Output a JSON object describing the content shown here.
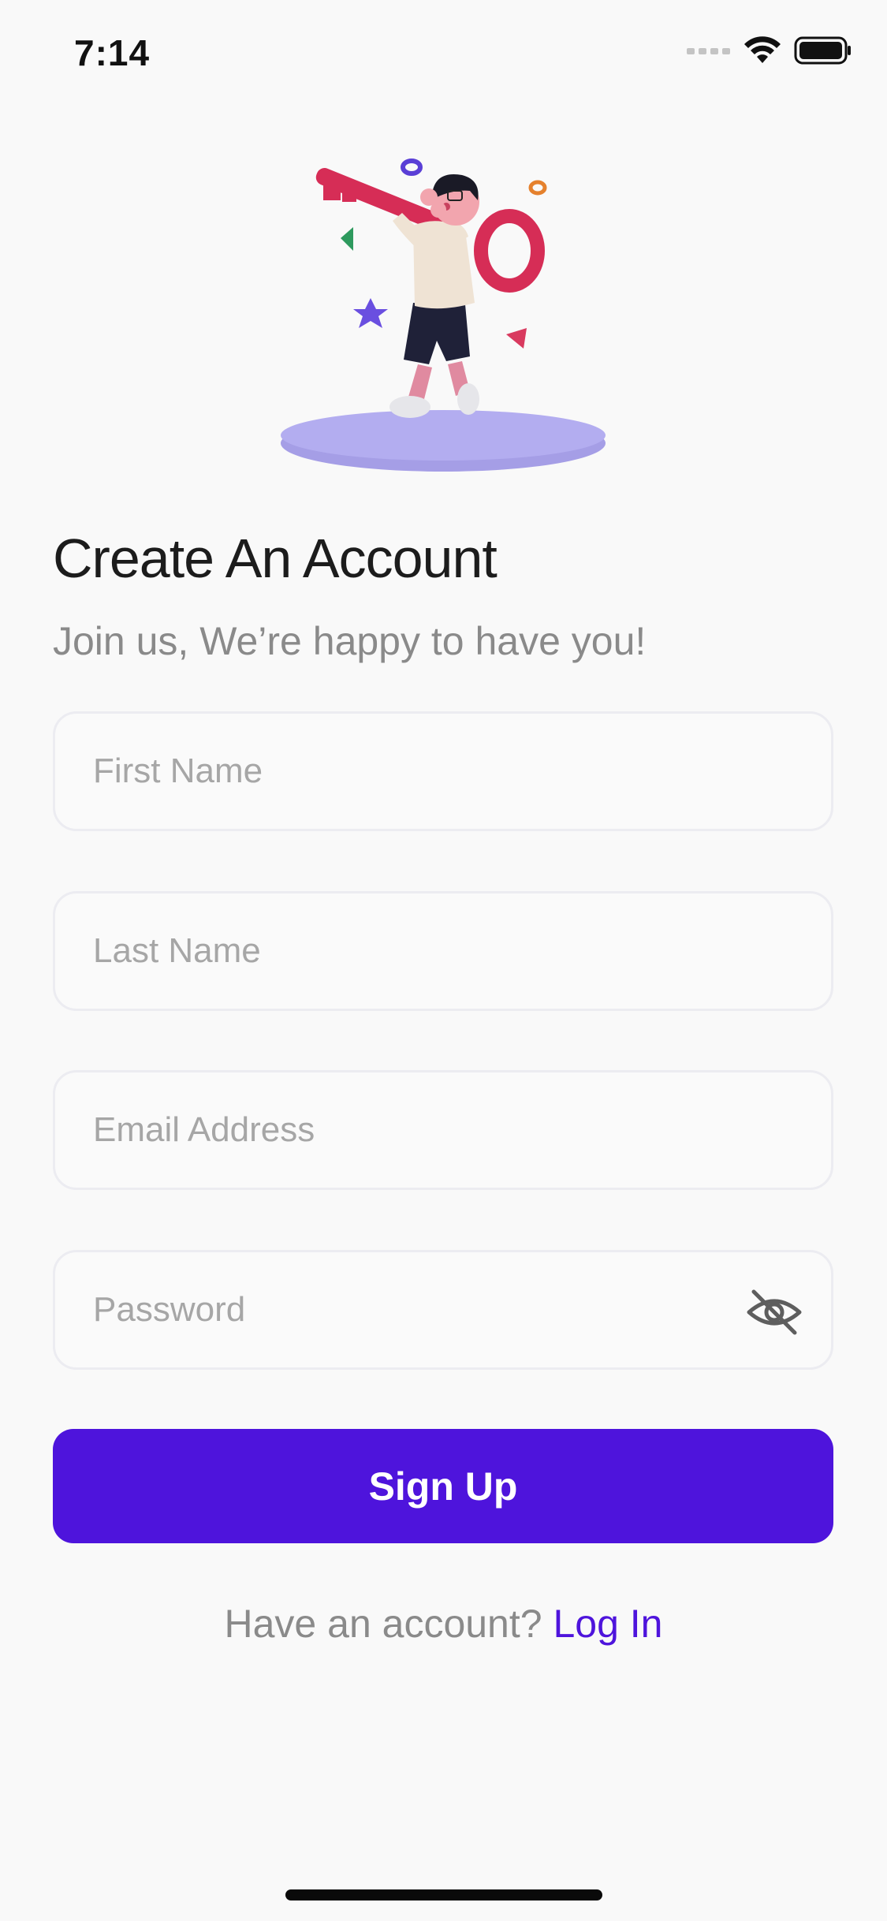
{
  "status_bar": {
    "time": "7:14"
  },
  "header": {
    "title": "Create An Account",
    "subtitle": "Join us, We’re happy to have you!"
  },
  "form": {
    "first_name": {
      "placeholder": "First Name",
      "value": ""
    },
    "last_name": {
      "placeholder": "Last Name",
      "value": ""
    },
    "email": {
      "placeholder": "Email Address",
      "value": ""
    },
    "password": {
      "placeholder": "Password",
      "value": "",
      "toggle_icon": "eye-slash-icon"
    },
    "submit_label": "Sign Up"
  },
  "footer": {
    "question": "Have an account?",
    "login_label": "Log In"
  },
  "colors": {
    "accent": "#4e14dc",
    "background": "#f9f9f9",
    "title": "#1c1c1c",
    "muted": "#8a8a8a",
    "field_border": "#ececf1"
  }
}
